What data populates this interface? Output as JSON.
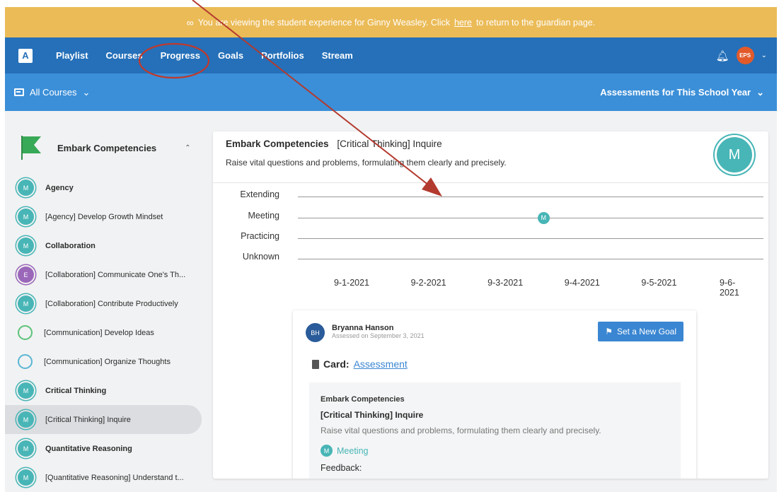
{
  "banner": {
    "prefix": "You are viewing the student experience for Ginny Weasley. Click",
    "link": "here",
    "suffix": "to return to the guardian page.",
    "icon": "glasses-icon"
  },
  "nav": {
    "logo": "A",
    "items": [
      "Playlist",
      "Courses",
      "Progress",
      "Goals",
      "Portfolios",
      "Stream"
    ],
    "avatar": "EPS"
  },
  "subnav": {
    "courses": "All Courses",
    "filter": "Assessments for This School Year"
  },
  "sidebar": {
    "title": "Embark Competencies",
    "items": [
      {
        "label": "Agency",
        "badge": "M",
        "bold": true
      },
      {
        "label": "[Agency] Develop Growth Mindset",
        "badge": "M",
        "bold": false
      },
      {
        "label": "Collaboration",
        "badge": "M",
        "bold": true
      },
      {
        "label": "[Collaboration] Communicate One's Th...",
        "badge": "E",
        "bold": false
      },
      {
        "label": "[Collaboration] Contribute Productively",
        "badge": "M",
        "bold": false
      },
      {
        "label": "[Communication] Develop Ideas",
        "badge": "",
        "bold": false
      },
      {
        "label": "[Communication] Organize Thoughts",
        "badge": "",
        "bold": false
      },
      {
        "label": "Critical Thinking",
        "badge": "M",
        "bold": true
      },
      {
        "label": "[Critical Thinking] Inquire",
        "badge": "M",
        "bold": false
      },
      {
        "label": "Quantitative Reasoning",
        "badge": "M",
        "bold": true
      },
      {
        "label": "[Quantitative Reasoning] Understand t...",
        "badge": "M",
        "bold": false
      }
    ]
  },
  "main": {
    "title": "Embark Competencies",
    "subtitle": "[Critical Thinking] Inquire",
    "description": "Raise vital questions and problems, formulating them clearly and precisely.",
    "level_badge": "M",
    "levels": [
      "Extending",
      "Meeting",
      "Practicing",
      "Unknown"
    ],
    "dates": [
      "9-1-2021",
      "9-2-2021",
      "9-3-2021",
      "9-4-2021",
      "9-5-2021",
      "9-6-2021"
    ],
    "point": {
      "date": "9-3-2021",
      "level": "Meeting",
      "label": "M"
    }
  },
  "assessment": {
    "initials": "BH",
    "name": "Bryanna Hanson",
    "date": "Assessed on September 3, 2021",
    "goal_button": "Set a New Goal",
    "card_label": "Card:",
    "card_link": "Assessment",
    "group": "Embark Competencies",
    "competency": "[Critical Thinking] Inquire",
    "description": "Raise vital questions and problems, formulating them clearly and precisely.",
    "level": "Meeting",
    "level_badge": "M",
    "feedback": "Feedback:"
  },
  "colors": {
    "banner": "#ebbb57",
    "nav": "#2570b9",
    "subnav": "#3b8fd8",
    "meeting": "#48b5b6",
    "extending": "#9a67b9",
    "annotation": "#c0392b"
  }
}
